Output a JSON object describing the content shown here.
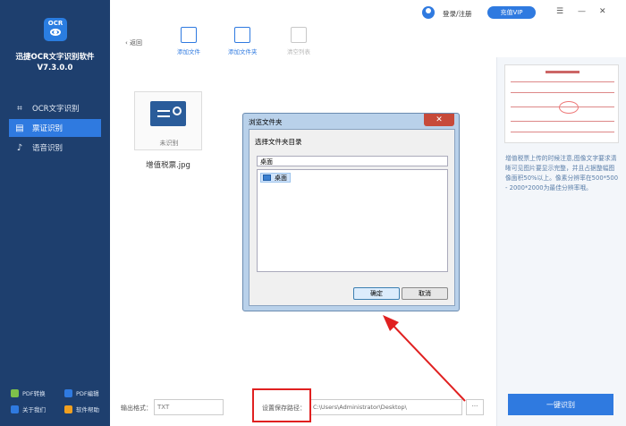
{
  "app": {
    "logo_text": "OCR",
    "name_line1": "迅捷OCR文字识别软件",
    "name_line2": "V7.3.0.0"
  },
  "sidebar": {
    "items": [
      {
        "label": "OCR文字识别",
        "icon": "scan-icon"
      },
      {
        "label": "票证识别",
        "icon": "ticket-icon"
      },
      {
        "label": "语音识别",
        "icon": "microphone-icon"
      }
    ],
    "bottom": [
      {
        "label": "PDF转换",
        "color": "#7ec04a"
      },
      {
        "label": "PDF编辑",
        "color": "#2f7ae0"
      },
      {
        "label": "关于我们",
        "color": "#2f7ae0"
      },
      {
        "label": "软件帮助",
        "color": "#f0a020"
      }
    ]
  },
  "header": {
    "login": "登录/注册",
    "vip": "充值VIP"
  },
  "toolbar": {
    "back": "返回",
    "add_file": "添加文件",
    "add_folder": "添加文件夹",
    "clear_list": "清空列表"
  },
  "file": {
    "status": "未识别",
    "name": "增值税票.jpg"
  },
  "right_panel": {
    "tip": "增值税票上传的时候注意,图像文字要求清晰可见图片要显示完整，并且占据整幅图像面积50%以上。像素分辨率在500*500 - 2000*2000为最佳分辨率哦。",
    "recognize_button": "一键识别"
  },
  "bottom_bar": {
    "format_label": "输出格式：",
    "format_value": "TXT",
    "path_label": "设置保存路径：",
    "path_value": "C:\\Users\\Administrator\\Desktop\\",
    "browse": "···"
  },
  "dialog": {
    "title": "浏览文件夹",
    "prompt": "选择文件夹目录",
    "input_value": "桌面",
    "tree_item": "桌面",
    "ok": "确定",
    "cancel": "取消",
    "close": "✕"
  },
  "colors": {
    "sidebar": "#1e3f6e",
    "accent": "#2f7ae0",
    "annotation": "#e02020"
  }
}
